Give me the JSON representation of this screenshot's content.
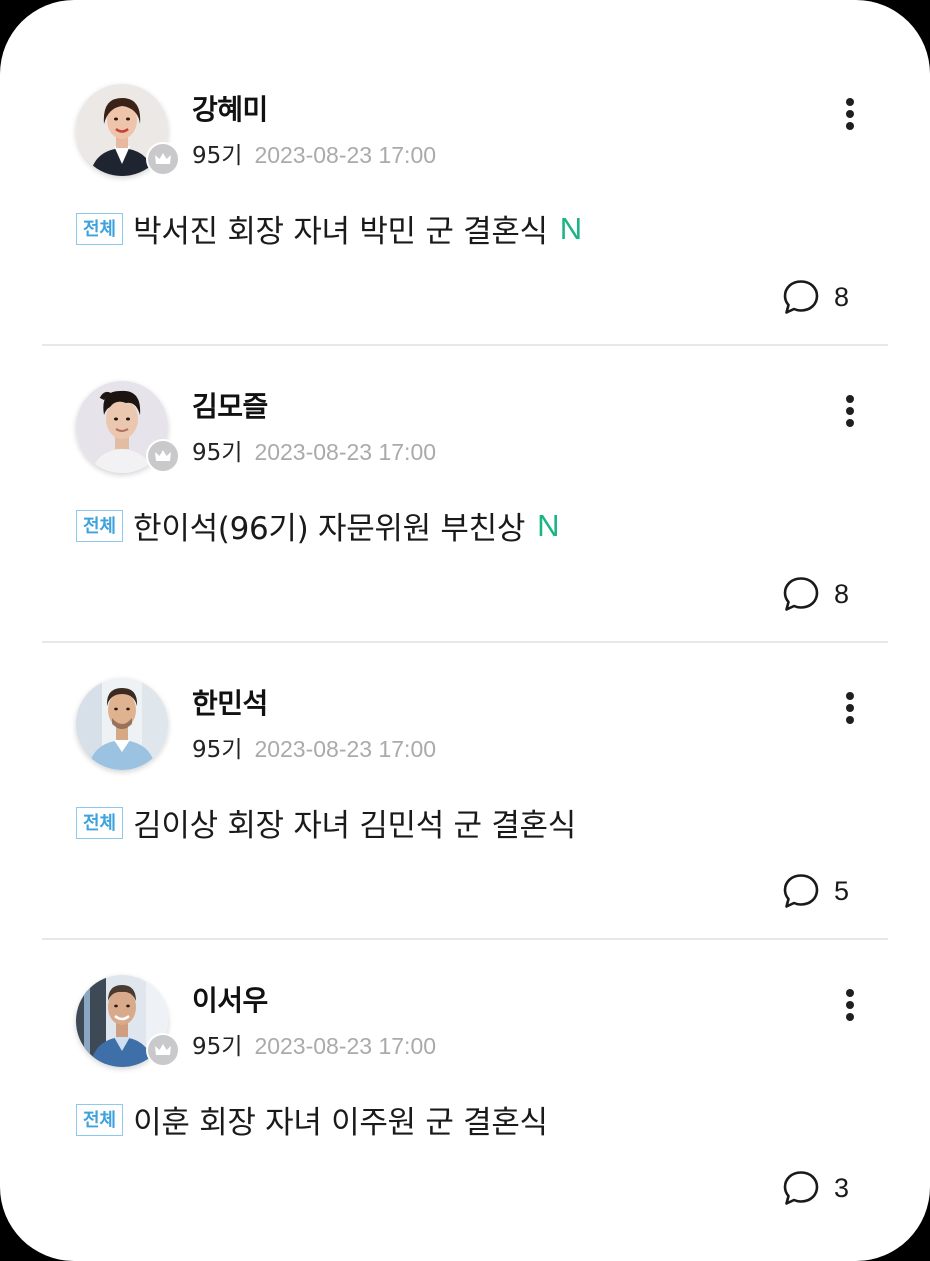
{
  "feed": {
    "posts": [
      {
        "author": "강혜미",
        "generation": "95기",
        "timestamp": "2023-08-23 17:00",
        "tag": "전체",
        "title": "박서진 회장 자녀 박민 군 결혼식",
        "new_mark": "N",
        "comment_count": "8",
        "avatar_icon": "person-photo-woman",
        "badge_icon": "crown-icon"
      },
      {
        "author": "김모즐",
        "generation": "95기",
        "timestamp": "2023-08-23 17:00",
        "tag": "전체",
        "title": "한이석(96기) 자문위원 부친상",
        "new_mark": "N",
        "comment_count": "8",
        "avatar_icon": "person-photo-man",
        "badge_icon": "crown-icon"
      },
      {
        "author": "한민석",
        "generation": "95기",
        "timestamp": "2023-08-23 17:00",
        "tag": "전체",
        "title": "김이상 회장 자녀 김민석 군 결혼식",
        "new_mark": "",
        "comment_count": "5",
        "avatar_icon": "person-photo-man",
        "badge_icon": ""
      },
      {
        "author": "이서우",
        "generation": "95기",
        "timestamp": "2023-08-23 17:00",
        "tag": "전체",
        "title": "이훈 회장 자녀 이주원 군 결혼식",
        "new_mark": "",
        "comment_count": "3",
        "avatar_icon": "person-photo-man",
        "badge_icon": "crown-icon"
      }
    ]
  },
  "colors": {
    "tag_border": "#8ec9ee",
    "tag_text": "#3da2dd",
    "new_mark": "#1bb585",
    "meta_text": "#aaaaaa",
    "crown_badge": "#c9c9cc"
  }
}
